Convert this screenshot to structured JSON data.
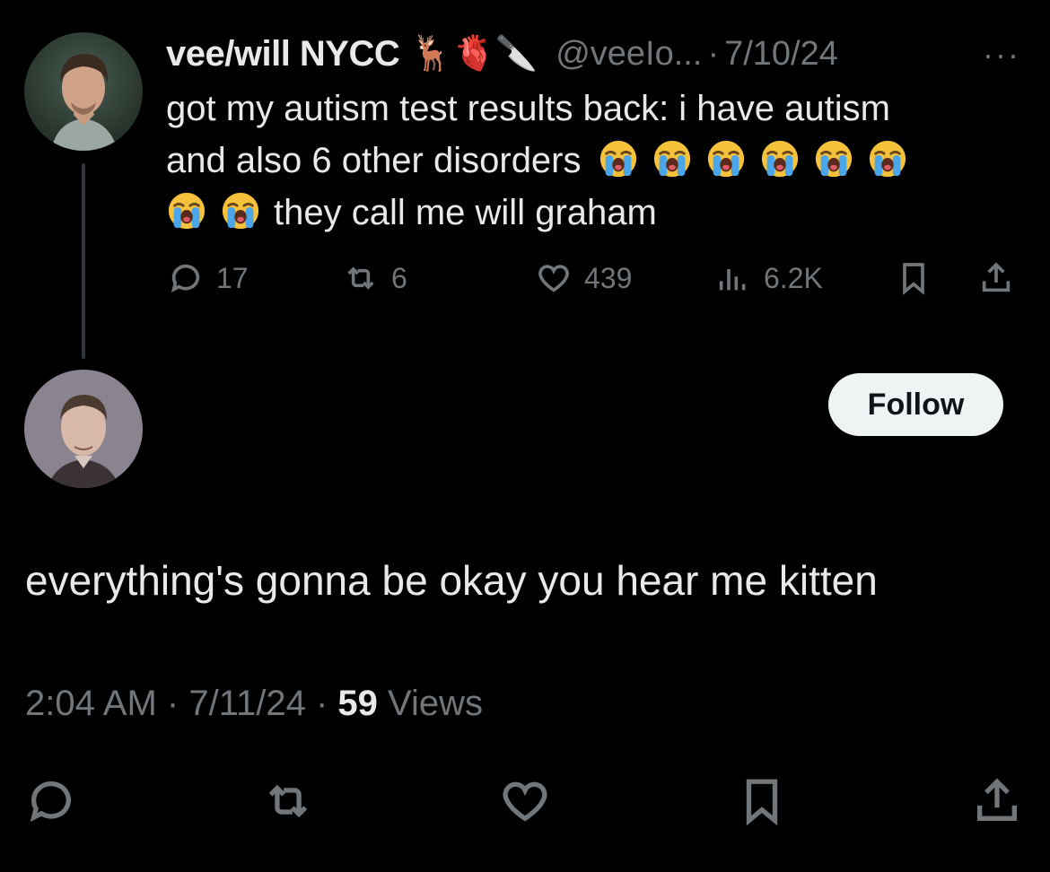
{
  "original_tweet": {
    "display_name": "vee/will NYCC",
    "name_emojis": "🦌🫀🔪",
    "handle": "@veeIo...",
    "separator": "·",
    "date": "7/10/24",
    "more_label": "···",
    "text_line1": "got my autism test results back: i have autism",
    "text_line2_prefix": "and also 6 other disorders",
    "text_line3_suffix": "they call me will graham",
    "stats": {
      "replies": "17",
      "reposts": "6",
      "likes": "439",
      "views": "6.2K"
    }
  },
  "reply": {
    "follow_label": "Follow",
    "text": "everything's gonna be okay you hear me kitten",
    "time": "2:04 AM",
    "date": "7/11/24",
    "separator": "·",
    "views_count": "59",
    "views_label": "Views"
  },
  "colors": {
    "background": "#000000",
    "text": "#e7e9ea",
    "muted": "#71767b",
    "follow_bg": "#eff3f4"
  }
}
